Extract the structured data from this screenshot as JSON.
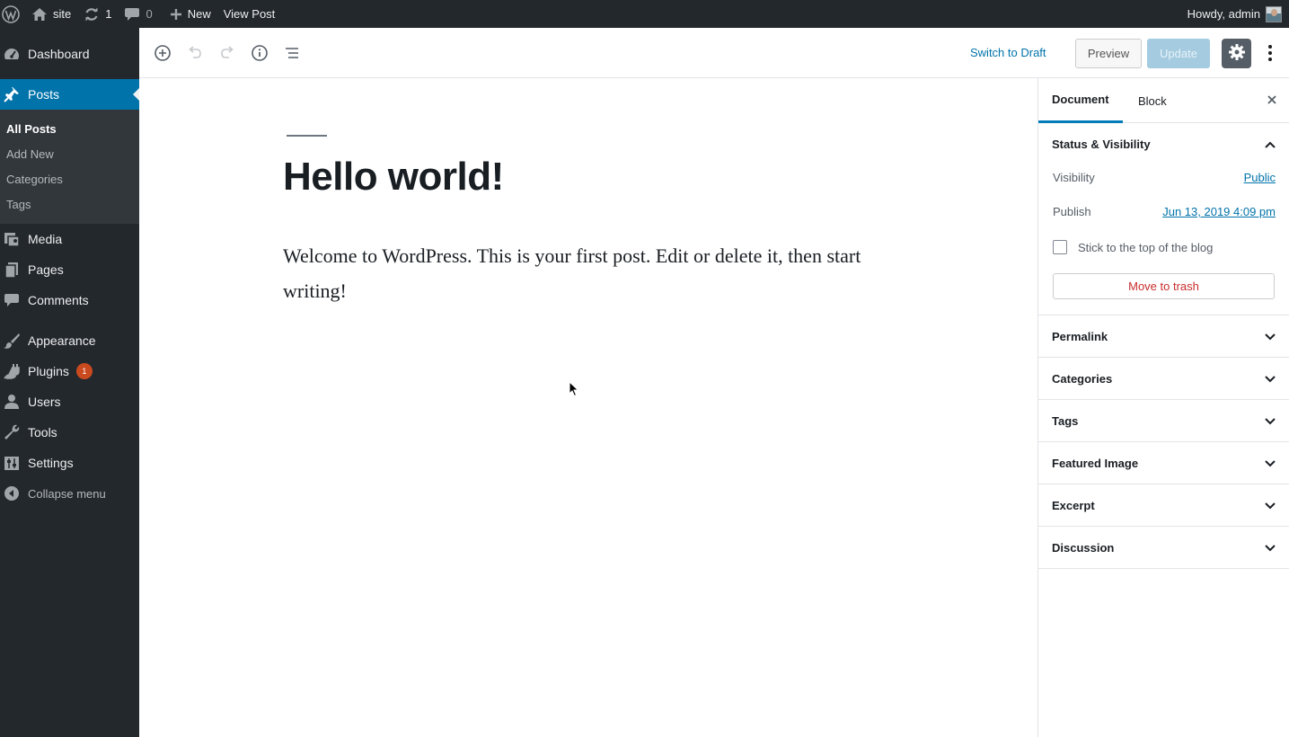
{
  "adminbar": {
    "site_name": "site",
    "updates_count": "1",
    "comments_count": "0",
    "new_label": "New",
    "view_post_label": "View Post",
    "greeting": "Howdy, admin"
  },
  "sidebar": {
    "dashboard": "Dashboard",
    "posts": "Posts",
    "submenu": {
      "all_posts": "All Posts",
      "add_new": "Add New",
      "categories": "Categories",
      "tags": "Tags"
    },
    "media": "Media",
    "pages": "Pages",
    "comments": "Comments",
    "appearance": "Appearance",
    "plugins": "Plugins",
    "plugins_badge": "1",
    "users": "Users",
    "tools": "Tools",
    "settings": "Settings",
    "collapse": "Collapse menu"
  },
  "toolbar": {
    "switch_to_draft": "Switch to Draft",
    "preview": "Preview",
    "update": "Update"
  },
  "post": {
    "title": "Hello world!",
    "body": "Welcome to WordPress. This is your first post. Edit or delete it, then start writing!"
  },
  "panel": {
    "tabs": [
      "Document",
      "Block"
    ],
    "status_visibility": {
      "heading": "Status & Visibility",
      "visibility_label": "Visibility",
      "visibility_value": "Public",
      "publish_label": "Publish",
      "publish_value": "Jun 13, 2019 4:09 pm",
      "sticky_label": "Stick to the top of the blog",
      "trash_label": "Move to trash"
    },
    "sections": [
      "Permalink",
      "Categories",
      "Tags",
      "Featured Image",
      "Excerpt",
      "Discussion"
    ]
  },
  "colors": {
    "admin_dark": "#23282d",
    "submenu_dark": "#32373c",
    "accent": "#0073aa",
    "badge": "#ca4a1f",
    "trash": "#c92c2c"
  }
}
